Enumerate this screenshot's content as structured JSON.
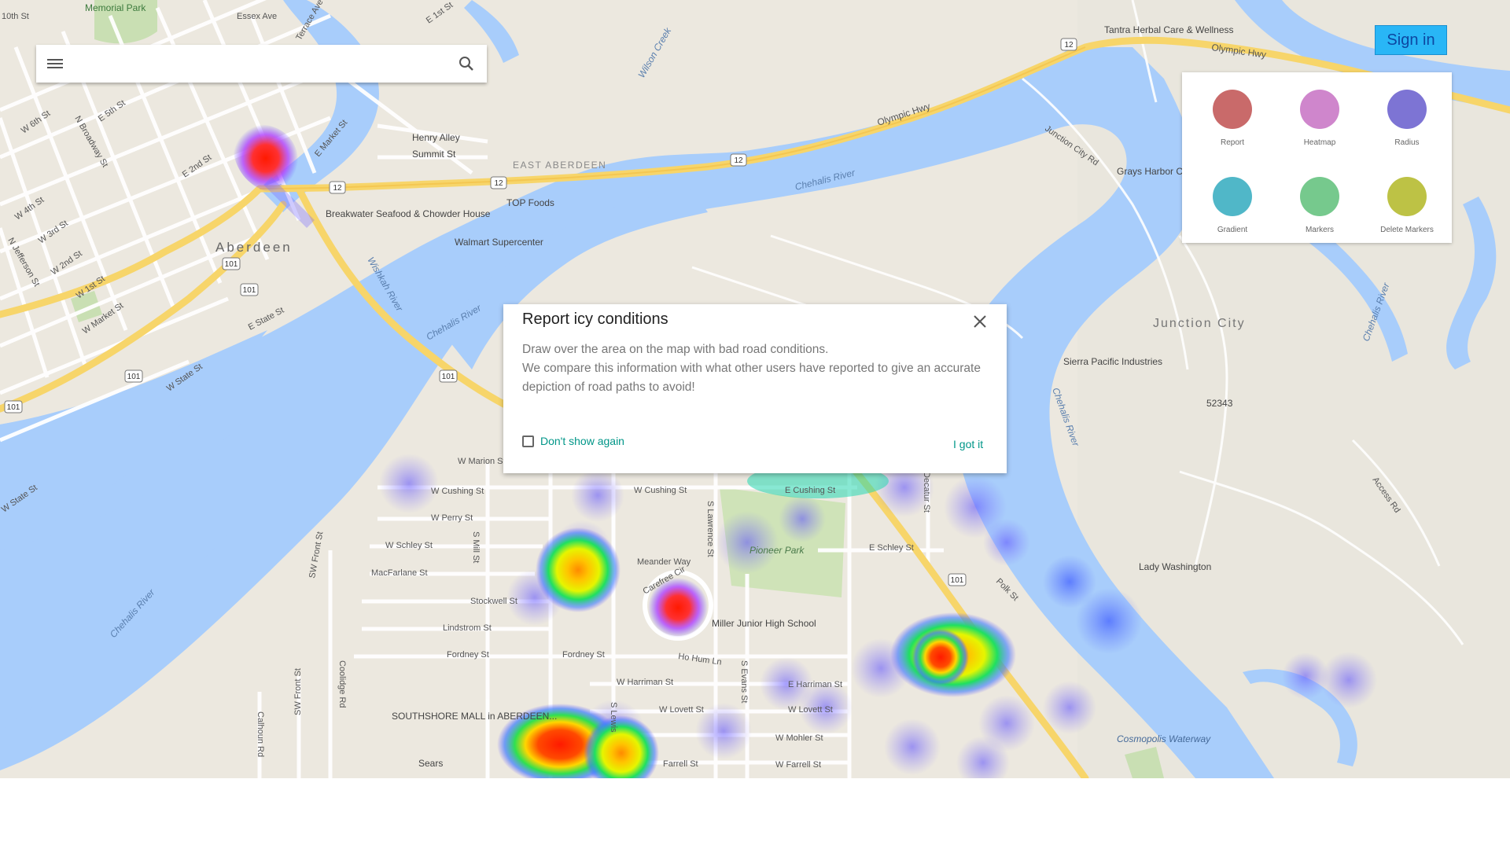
{
  "search": {
    "placeholder": ""
  },
  "header": {
    "sign_in_label": "Sign in"
  },
  "tools": [
    {
      "label": "Report",
      "color": "#c96a6a",
      "icon": "report-icon"
    },
    {
      "label": "Heatmap",
      "color": "#cf86cc",
      "icon": "heatmap-icon"
    },
    {
      "label": "Radius",
      "color": "#7d74d4",
      "icon": "radius-icon"
    },
    {
      "label": "Gradient",
      "color": "#50b7c8",
      "icon": "gradient-icon"
    },
    {
      "label": "Markers",
      "color": "#76c98d",
      "icon": "markers-icon"
    },
    {
      "label": "Delete Markers",
      "color": "#bdc245",
      "icon": "delete-markers-icon"
    }
  ],
  "dialog": {
    "title": "Report icy conditions",
    "body_line1": "Draw over the area on the map with bad road conditions.",
    "body_line2": "We compare this information with what other users have reported to give an accurate depiction of road paths to avoid!",
    "dont_show_label": "Don't show again",
    "confirm_label": "I got it"
  },
  "map": {
    "places": {
      "aberdeen": "Aberdeen",
      "east_aberdeen": "EAST ABERDEEN",
      "junction_city": "Junction City",
      "pioneer_park": "Pioneer Park",
      "memorial_park": "Memorial Park",
      "cosmopolis_waterway": "Cosmopolis Waterway",
      "walmart": "Walmart Supercenter",
      "top_foods": "TOP Foods",
      "breakwater": "Breakwater Seafood & Chowder House",
      "tantra": "Tantra Herbal Care & Wellness",
      "grays_harbor": "Grays Harbor County Juvenile",
      "sierra_pacific": "Sierra Pacific Industries",
      "lady_washington": "Lady Washington",
      "miller_junior": "Miller Junior High School",
      "southshore": "SOUTHSHORE MALL in ABERDEEN...",
      "sears": "Sears",
      "henry_alley": "Henry Alley",
      "summit_st": "Summit St",
      "zip": "52343"
    },
    "rivers": {
      "chehalis": "Chehalis River",
      "wishkah": "Wishkah River",
      "wilson_creek": "Wilson Creek"
    },
    "highways": {
      "olympic_hwy": "Olympic Hwy",
      "us12": "12",
      "us101": "101"
    },
    "streets": {
      "w_cushing": "W Cushing St",
      "e_cushing": "E Cushing St",
      "w_perry": "W Perry St",
      "w_schley": "W Schley St",
      "e_schley": "E Schley St",
      "macfarlane": "MacFarlane St",
      "stockwell": "Stockwell St",
      "lindstrom": "Lindstrom St",
      "fordney": "Fordney St",
      "w_harriman": "W Harriman St",
      "e_harriman": "E Harriman St",
      "w_lovett": "W Lovett St",
      "w_mohler": "W Mohler St",
      "farrell": "Farrell St",
      "w_farrell": "W Farrell St",
      "meander": "Meander Way",
      "carefree": "Carefree Cir",
      "ho_hum": "Ho Hum Ln",
      "w_marion": "W Marion St",
      "s_lawrence": "S Lawrence St",
      "s_evans": "S Evans St",
      "s_mill": "S Mill St",
      "s_lewis": "S Lewis",
      "sw_front": "SW Front St",
      "coolidge": "Coolidge Rd",
      "calhoun": "Calhoun Rd",
      "essex": "Essex Ave",
      "terrace": "Terrace Ave",
      "e_market": "E Market St",
      "w_market": "W Market St",
      "e_state": "E State St",
      "w_state": "W State St",
      "w_1st": "W 1st St",
      "w_2nd": "W 2nd St",
      "w_3rd": "W 3rd St",
      "w_4th": "W 4th St",
      "w_6th": "W 6th St",
      "e_2nd": "E 2nd St",
      "e_5th": "E 5th St",
      "e_1st": "E 1st St",
      "n_broadway": "N Broadway St",
      "n_jefferson": "N Jefferson St",
      "junction_city_rd": "Junction City Rd",
      "acces_rd": "Access Rd",
      "polk": "Polk St",
      "decatur": "Decatur St",
      "tenth": "10th St"
    }
  }
}
